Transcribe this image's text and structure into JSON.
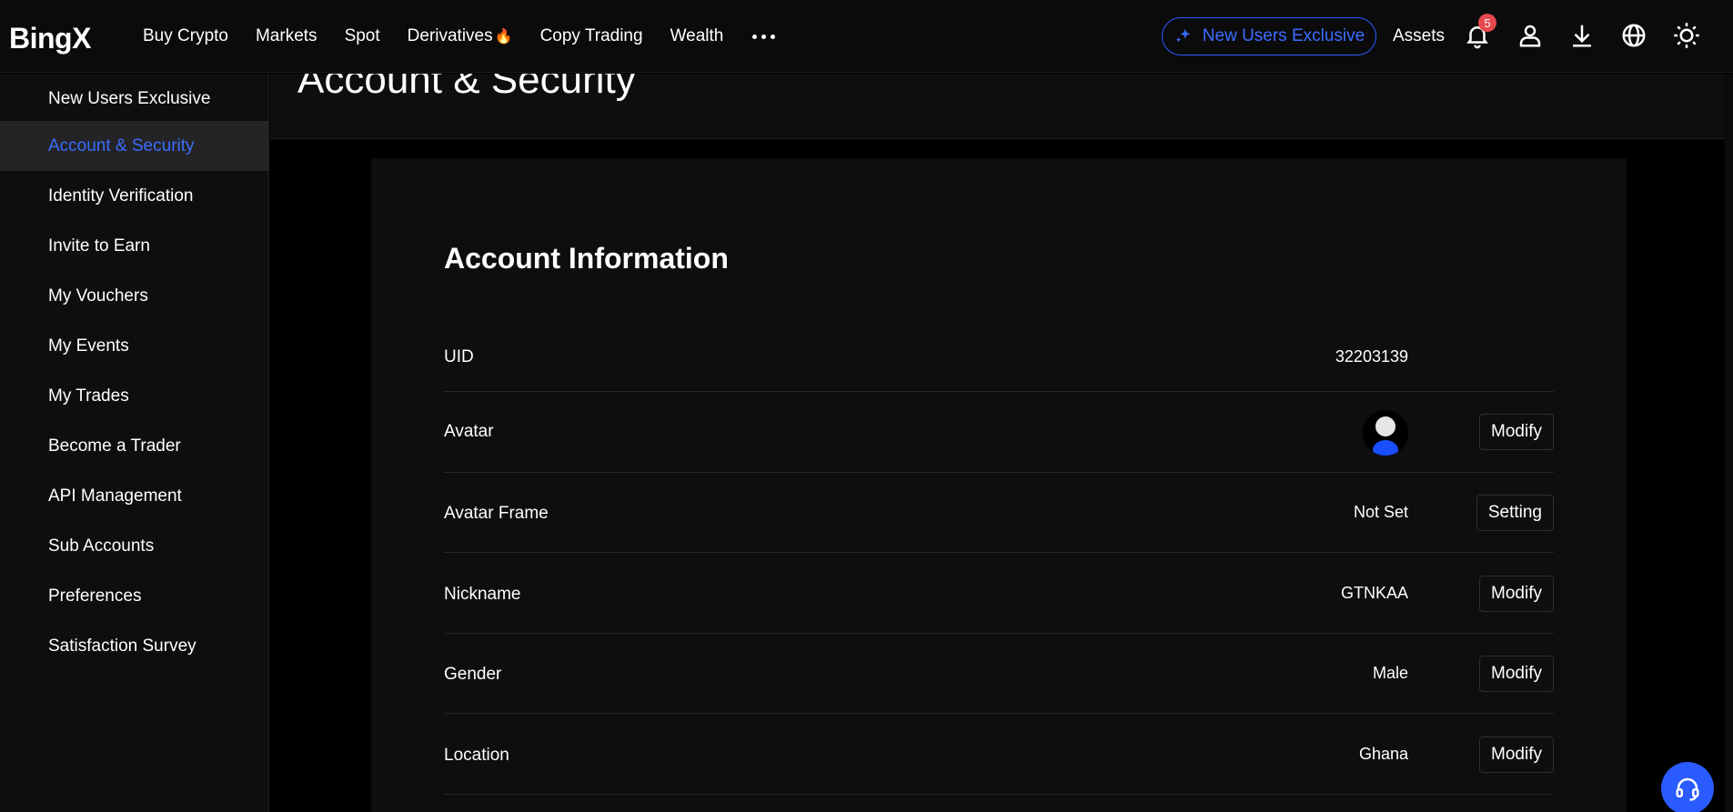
{
  "brand": {
    "logo_text": "BingX",
    "accent": "#2a5bff",
    "bg": "#000000"
  },
  "nav": {
    "items": [
      {
        "label": "Buy Crypto"
      },
      {
        "label": "Markets"
      },
      {
        "label": "Spot"
      },
      {
        "label": "Derivatives",
        "icon": "flame-icon"
      },
      {
        "label": "Copy Trading"
      },
      {
        "label": "Wealth"
      }
    ],
    "new_users_label": "New Users Exclusive",
    "assets_label": "Assets",
    "notification_count": "5"
  },
  "sidebar": {
    "items": [
      {
        "label": "New Users Exclusive"
      },
      {
        "label": "Account & Security",
        "active": true
      },
      {
        "label": "Identity Verification"
      },
      {
        "label": "Invite to Earn"
      },
      {
        "label": "My Vouchers"
      },
      {
        "label": "My Events"
      },
      {
        "label": "My Trades"
      },
      {
        "label": "Become a Trader"
      },
      {
        "label": "API Management"
      },
      {
        "label": "Sub Accounts"
      },
      {
        "label": "Preferences"
      },
      {
        "label": "Satisfaction Survey"
      }
    ]
  },
  "page": {
    "title": "Account & Security"
  },
  "account_info": {
    "title": "Account Information",
    "rows": [
      {
        "label": "UID",
        "value": "32203139"
      },
      {
        "label": "Avatar",
        "action": "Modify"
      },
      {
        "label": "Avatar Frame",
        "value": "Not Set",
        "action": "Setting"
      },
      {
        "label": "Nickname",
        "value": "GTNKAA",
        "action": "Modify"
      },
      {
        "label": "Gender",
        "value": "Male",
        "action": "Modify"
      },
      {
        "label": "Location",
        "value": "Ghana",
        "action": "Modify"
      }
    ]
  }
}
